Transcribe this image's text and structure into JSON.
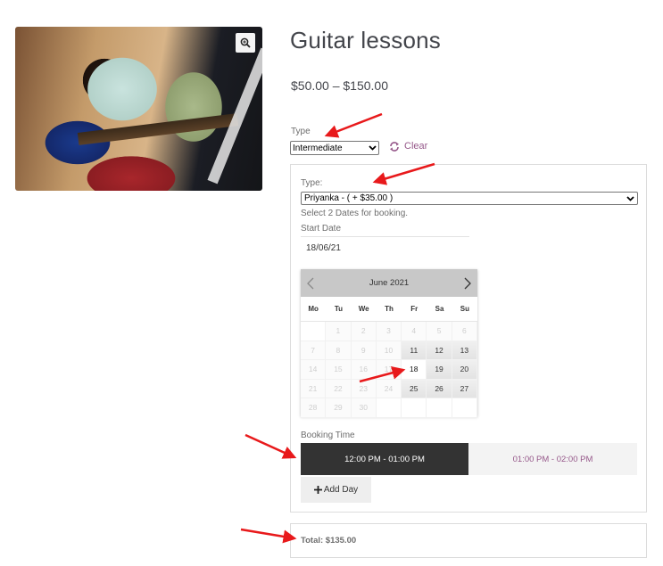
{
  "product": {
    "title": "Guitar lessons",
    "price_range": "$50.00 – $150.00",
    "image_alt": "Guitar lesson photo"
  },
  "variation": {
    "label": "Type",
    "selected": "Intermediate",
    "clear_label": "Clear"
  },
  "booking": {
    "type_label": "Type:",
    "type_selected": "Priyanka - ( + $35.00 )",
    "hint": "Select 2 Dates for booking.",
    "start_date_label": "Start Date",
    "start_date_value": "18/06/21",
    "calendar": {
      "month": "June 2021",
      "weekdays": [
        "Mo",
        "Tu",
        "We",
        "Th",
        "Fr",
        "Sa",
        "Su"
      ],
      "leading_blanks": 1,
      "days_in_month": 30,
      "available_days": [
        11,
        12,
        13,
        19,
        20,
        25,
        26,
        27
      ],
      "selected_day": 18
    },
    "time_label": "Booking Time",
    "time_slots": [
      {
        "label": "12:00 PM - 01:00 PM",
        "selected": true
      },
      {
        "label": "01:00 PM - 02:00 PM",
        "selected": false
      }
    ],
    "add_day_label": "Add Day"
  },
  "total": {
    "label": "Total: $135.00"
  },
  "colors": {
    "accent": "#96588a",
    "annotation_arrow": "#e8191b",
    "slot_active_bg": "#333333"
  }
}
